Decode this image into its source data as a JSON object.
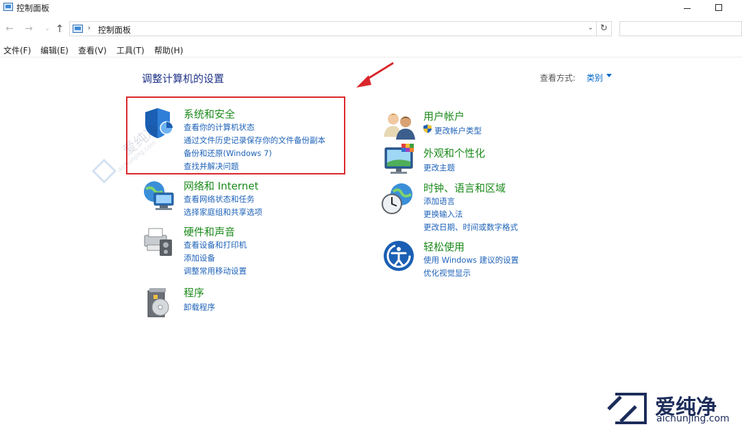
{
  "window": {
    "title": "控制面板"
  },
  "nav": {
    "address": "控制面板",
    "separator": "›"
  },
  "menu": {
    "items": [
      "文件(F)",
      "编辑(E)",
      "查看(V)",
      "工具(T)",
      "帮助(H)"
    ]
  },
  "content": {
    "heading": "调整计算机的设置",
    "view_by_label": "查看方式:",
    "view_by_value": "类别",
    "categories": [
      {
        "title": "系统和安全",
        "icon": "shield-icon",
        "links": [
          "查看你的计算机状态",
          "通过文件历史记录保存你的文件备份副本",
          "备份和还原(Windows 7)",
          "查找并解决问题"
        ]
      },
      {
        "title": "网络和 Internet",
        "icon": "network-globe-icon",
        "links": [
          "查看网络状态和任务",
          "选择家庭组和共享选项"
        ]
      },
      {
        "title": "硬件和声音",
        "icon": "printer-speaker-icon",
        "links": [
          "查看设备和打印机",
          "添加设备",
          "调整常用移动设置"
        ]
      },
      {
        "title": "程序",
        "icon": "program-disc-icon",
        "links": [
          "卸载程序"
        ]
      },
      {
        "title": "用户帐户",
        "icon": "users-icon",
        "links": [
          "更改帐户类型"
        ]
      },
      {
        "title": "外观和个性化",
        "icon": "monitor-palette-icon",
        "links": [
          "更改主题"
        ]
      },
      {
        "title": "时钟、语言和区域",
        "icon": "clock-globe-icon",
        "links": [
          "添加语言",
          "更换输入法",
          "更改日期、时间或数字格式"
        ]
      },
      {
        "title": "轻松使用",
        "icon": "ease-of-access-icon",
        "links": [
          "使用 Windows 建议的设置",
          "优化视觉显示"
        ]
      }
    ]
  },
  "watermark": {
    "brand": "爱纯净",
    "url": "aichunjing.com"
  },
  "colors": {
    "category_title": "#1c8a1c",
    "link": "#1e62b8",
    "heading": "#1e3287",
    "highlight": "#d9262b"
  }
}
